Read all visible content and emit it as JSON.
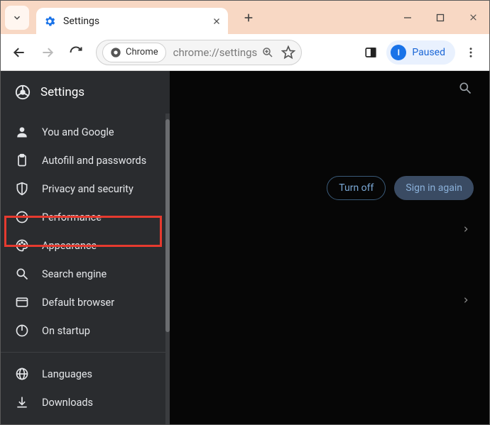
{
  "tab": {
    "title": "Settings"
  },
  "toolbar": {
    "chrome_chip": "Chrome",
    "url": "chrome://settings"
  },
  "profile": {
    "initial": "I",
    "status": "Paused"
  },
  "sidebar": {
    "header": "Settings",
    "items": {
      "you": "You and Google",
      "autofill": "Autofill and passwords",
      "privacy": "Privacy and security",
      "performance": "Performance",
      "appearance": "Appearance",
      "search": "Search engine",
      "default_browser": "Default browser",
      "startup": "On startup",
      "languages": "Languages",
      "downloads": "Downloads"
    }
  },
  "main": {
    "turn_off": "Turn off",
    "sign_in_again": "Sign in again"
  },
  "highlighted_item": "privacy"
}
